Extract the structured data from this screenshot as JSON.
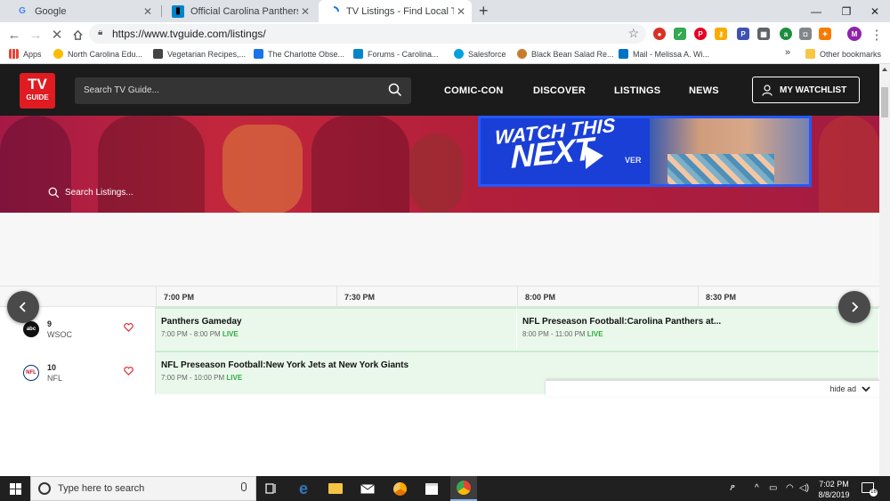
{
  "browser": {
    "tabs": [
      {
        "title": "Google",
        "favicon": "google-g-icon",
        "active": false
      },
      {
        "title": "Official Carolina Panthers at Chic",
        "favicon": "panthers-icon",
        "active": false
      },
      {
        "title": "TV Listings - Find Local TV Shows",
        "favicon": "loading-spinner-icon",
        "active": true
      }
    ],
    "new_tab_label": "+",
    "url": "https://www.tvguide.com/listings/",
    "profile_initial": "M",
    "bookmarks": [
      {
        "label": "Apps",
        "color": "#ea4335"
      },
      {
        "label": "North Carolina Edu...",
        "color": "#fbbc04"
      },
      {
        "label": "Vegetarian Recipes,...",
        "color": "#444444"
      },
      {
        "label": "The Charlotte Obse...",
        "color": "#1a73e8"
      },
      {
        "label": "Forums - Carolina...",
        "color": "#0085ca"
      },
      {
        "label": "Salesforce",
        "color": "#00a1e0"
      },
      {
        "label": "Black Bean Salad Re...",
        "color": "#c77d2e"
      },
      {
        "label": "Mail - Melissa A. Wi...",
        "color": "#0072c6"
      }
    ],
    "bookmarks_overflow": "»",
    "other_bookmarks": "Other bookmarks"
  },
  "site": {
    "logo_top": "TV",
    "logo_bottom": "GUIDE",
    "search_placeholder": "Search TV Guide...",
    "nav": [
      "COMIC-CON",
      "DISCOVER",
      "LISTINGS",
      "NEWS"
    ],
    "watchlist_label": "MY WATCHLIST",
    "hero_search_placeholder": "Search Listings...",
    "promo_line1": "WATCH THIS",
    "promo_line2": "NEXT",
    "promo_partial_text": "VER"
  },
  "listings": {
    "times": [
      "7:00 PM",
      "7:30 PM",
      "8:00 PM",
      "8:30 PM"
    ],
    "channels": [
      {
        "number": "9",
        "callsign": "WSOC",
        "logo": "abc-logo",
        "logo_text": "abc",
        "programs": [
          {
            "title": "Panthers Gameday",
            "time": "7:00 PM - 8:00 PM",
            "status": "LIVE"
          },
          {
            "title": "NFL Preseason Football:Carolina Panthers at...",
            "time": "8:00 PM - 11:00 PM",
            "status": "LIVE"
          }
        ]
      },
      {
        "number": "10",
        "callsign": "NFL",
        "logo": "nfl-network-logo",
        "logo_text": "NFL",
        "programs": [
          {
            "title": "NFL Preseason Football:New York Jets at New York Giants",
            "time": "7:00 PM - 10:00 PM",
            "status": "LIVE"
          }
        ]
      }
    ],
    "hide_ad_label": "hide ad"
  },
  "taskbar": {
    "search_placeholder": "Type here to search",
    "time": "7:02 PM",
    "date": "8/8/2019",
    "notification_count": "16"
  },
  "colors": {
    "brand_red": "#e01b22",
    "live_green": "#2eab44",
    "header_dark": "#1b1b1b"
  }
}
